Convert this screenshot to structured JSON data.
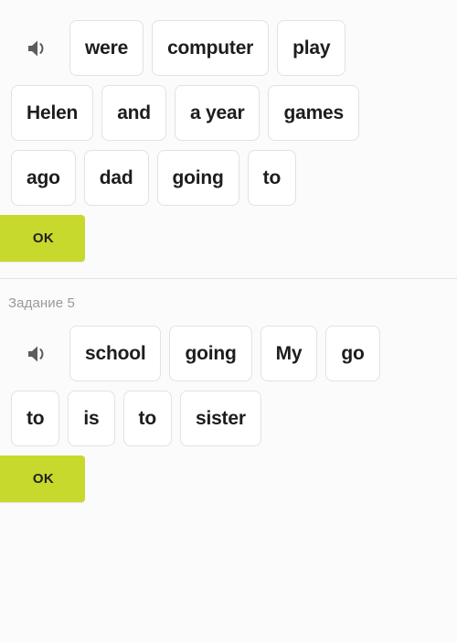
{
  "page": {
    "background_color": "#fbfbfb",
    "accent_color": "#c6d92c",
    "chip_border_color": "#e2e2e2",
    "label_color": "#9a9a9a"
  },
  "exercises": [
    {
      "id": "exercise-4",
      "task_label": "",
      "speaker_icon": "speaker-icon",
      "rows": [
        {
          "has_speaker": true,
          "words": [
            "were",
            "computer",
            "play"
          ]
        },
        {
          "has_speaker": false,
          "words": [
            "Helen",
            "and",
            "a year",
            "games"
          ]
        },
        {
          "has_speaker": false,
          "words": [
            "ago",
            "dad",
            "going",
            "to"
          ]
        }
      ],
      "ok_label": "OK"
    },
    {
      "id": "exercise-5",
      "task_label": "Задание 5",
      "speaker_icon": "speaker-icon",
      "rows": [
        {
          "has_speaker": true,
          "words": [
            "school",
            "going",
            "My",
            "go"
          ]
        },
        {
          "has_speaker": false,
          "words": [
            "to",
            "is",
            "to",
            "sister"
          ]
        }
      ],
      "ok_label": "OK"
    }
  ]
}
